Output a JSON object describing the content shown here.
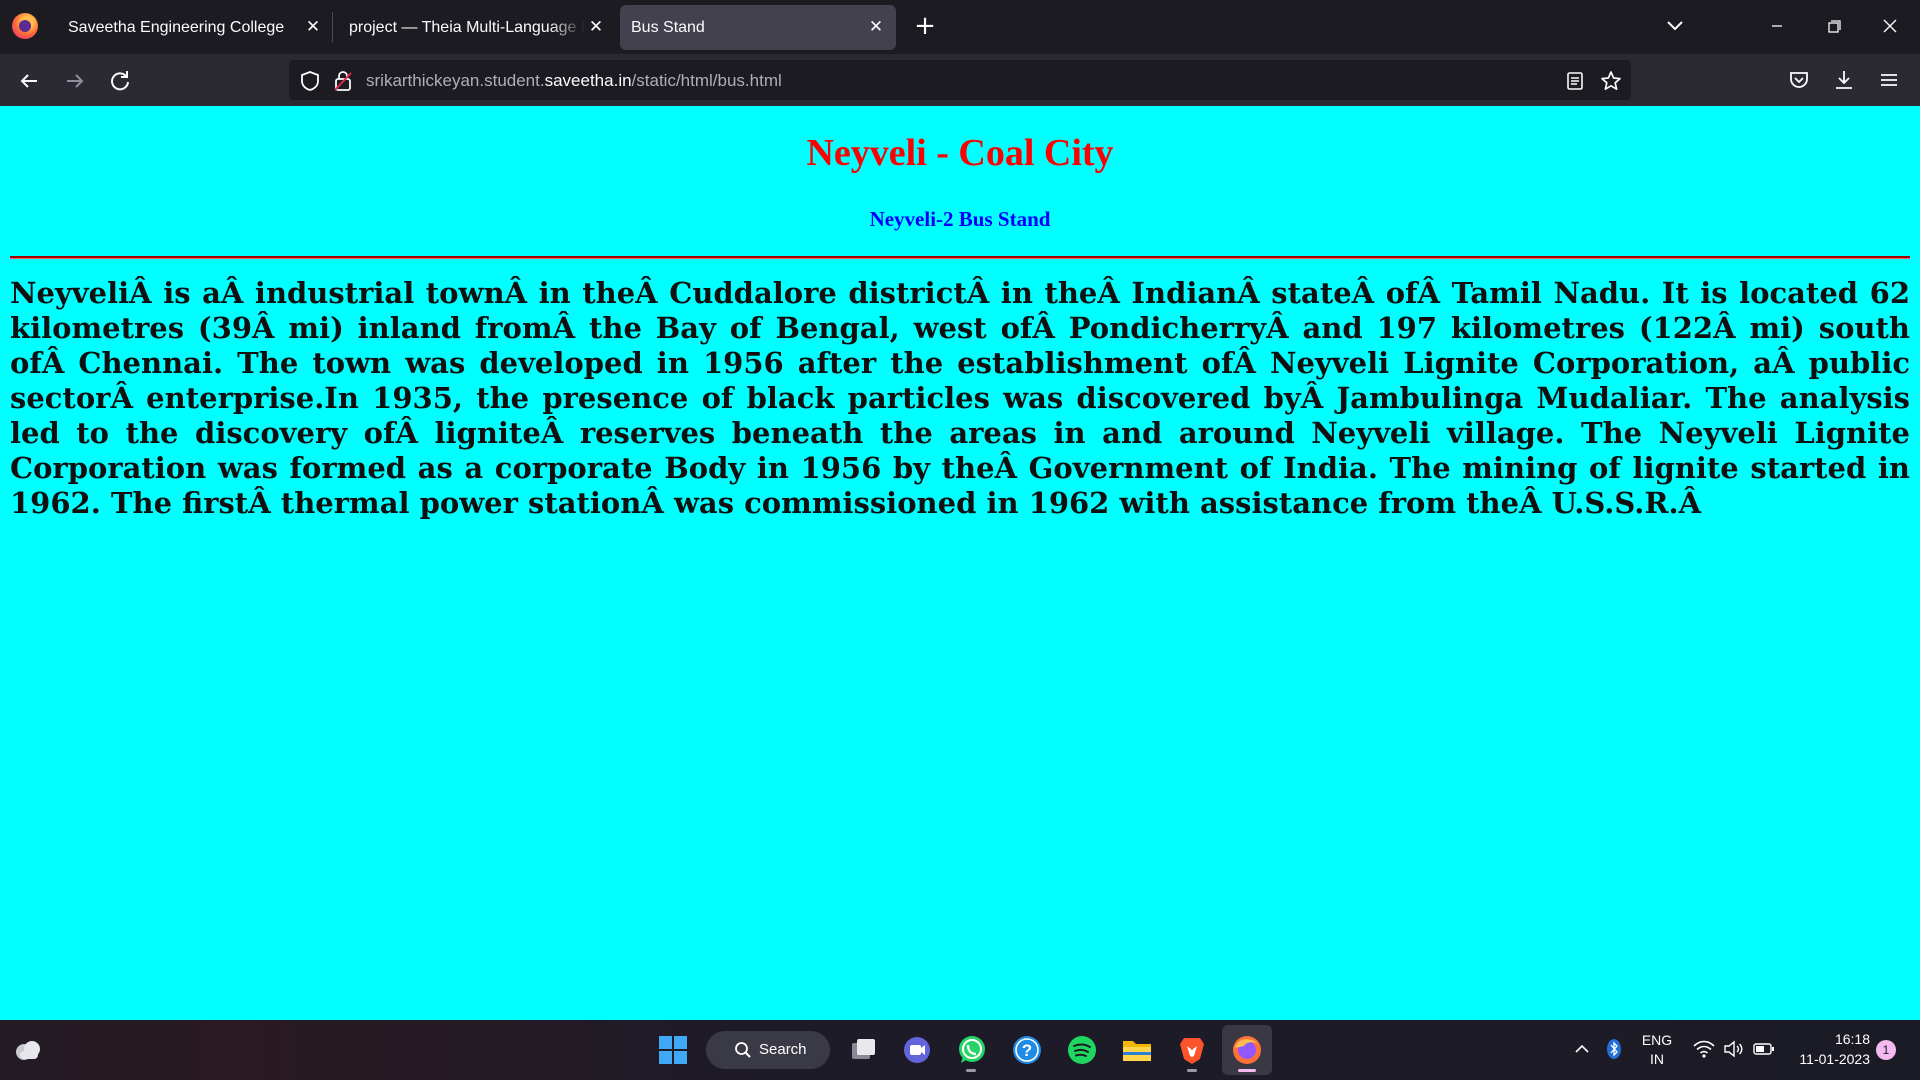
{
  "browser": {
    "tabs": [
      {
        "label": "Saveetha Engineering College",
        "active": false
      },
      {
        "label": "project — Theia Multi-Language Ex",
        "active": false
      },
      {
        "label": "Bus Stand",
        "active": true
      }
    ],
    "close_glyph": "✕",
    "new_tab_glyph": "+",
    "url_prefix": "srikarthickeyan.student.",
    "url_domain": "saveetha.in",
    "url_path": "/static/html/bus.html"
  },
  "page": {
    "background": "#00ffff",
    "title": "Neyveli - Coal City",
    "title_color": "#ff0000",
    "subtitle": "Neyveli-2 Bus Stand",
    "subtitle_color": "#0000ff",
    "body_text": "NeyveliÂ is aÂ industrial townÂ in theÂ Cuddalore districtÂ in theÂ IndianÂ stateÂ ofÂ Tamil Nadu. It is located 62 kilometres (39Â mi) inland fromÂ the Bay of Bengal, west ofÂ PondicherryÂ and 197 kilometres (122Â mi) south ofÂ Chennai. The town was developed in 1956 after the establishment ofÂ Neyveli Lignite Corporation, aÂ public sectorÂ enterprise.In 1935, the presence of black particles was discovered byÂ Jambulinga Mudaliar. The analysis led to the discovery ofÂ ligniteÂ reserves beneath the areas in and around Neyveli village. The Neyveli Lignite Corporation was formed as a corporate Body in 1956 by theÂ Government of India. The mining of lignite started in 1962. The firstÂ thermal power stationÂ was commissioned in 1962 with assistance from theÂ U.S.S.R.Â"
  },
  "taskbar": {
    "search_label": "Search",
    "apps": [
      "task-view-icon",
      "teams-chat-icon",
      "whatsapp-icon",
      "help-icon",
      "spotify-icon",
      "file-explorer-icon",
      "brave-icon",
      "firefox-icon"
    ],
    "language": "ENG",
    "region": "IN",
    "time": "16:18",
    "date": "11-01-2023",
    "notification_count": "1"
  }
}
